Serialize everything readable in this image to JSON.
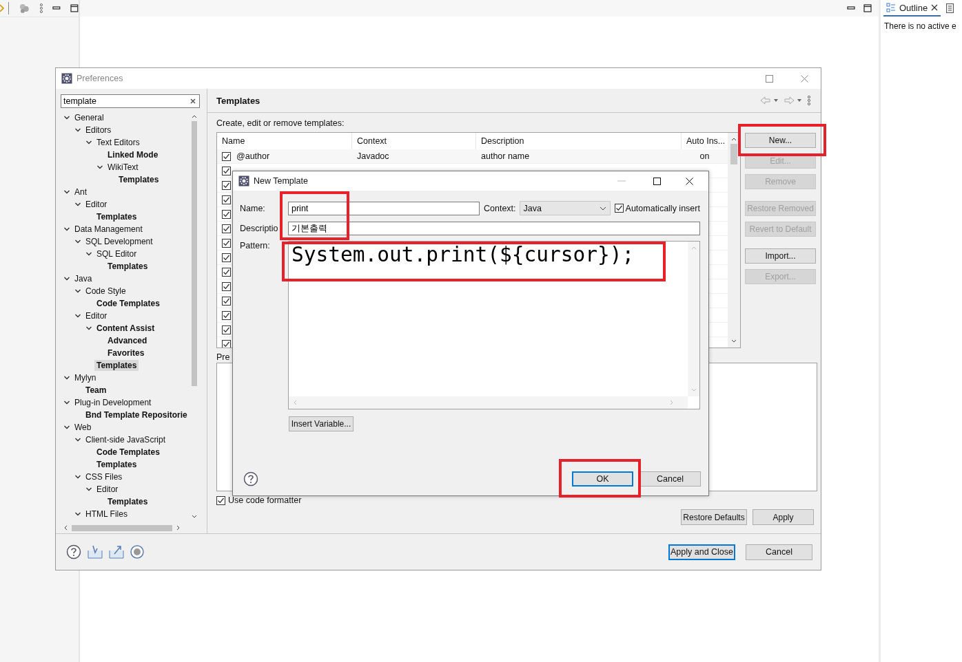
{
  "workbench": {
    "outline_tab": {
      "label": "Outline"
    },
    "outline_message": "There is no active e"
  },
  "preferences": {
    "title": "Preferences",
    "filter": {
      "value": "template"
    },
    "tree": [
      {
        "label": "General",
        "expanded": true,
        "matched": false,
        "selected": false,
        "children": [
          {
            "label": "Editors",
            "expanded": true,
            "matched": false,
            "selected": false,
            "children": [
              {
                "label": "Text Editors",
                "expanded": true,
                "matched": false,
                "selected": false,
                "children": [
                  {
                    "label": "Linked Mode",
                    "matched": true,
                    "selected": false
                  },
                  {
                    "label": "WikiText",
                    "expanded": true,
                    "matched": false,
                    "selected": false,
                    "children": [
                      {
                        "label": "Templates",
                        "matched": true,
                        "selected": false
                      }
                    ]
                  }
                ]
              }
            ]
          }
        ]
      },
      {
        "label": "Ant",
        "expanded": true,
        "matched": false,
        "selected": false,
        "children": [
          {
            "label": "Editor",
            "expanded": true,
            "matched": false,
            "selected": false,
            "children": [
              {
                "label": "Templates",
                "matched": true,
                "selected": false
              }
            ]
          }
        ]
      },
      {
        "label": "Data Management",
        "expanded": true,
        "matched": false,
        "selected": false,
        "children": [
          {
            "label": "SQL Development",
            "expanded": true,
            "matched": false,
            "selected": false,
            "children": [
              {
                "label": "SQL Editor",
                "expanded": true,
                "matched": false,
                "selected": false,
                "children": [
                  {
                    "label": "Templates",
                    "matched": true,
                    "selected": false
                  }
                ]
              }
            ]
          }
        ]
      },
      {
        "label": "Java",
        "expanded": true,
        "matched": false,
        "selected": false,
        "children": [
          {
            "label": "Code Style",
            "expanded": true,
            "matched": false,
            "selected": false,
            "children": [
              {
                "label": "Code Templates",
                "matched": true,
                "selected": false
              }
            ]
          },
          {
            "label": "Editor",
            "expanded": true,
            "matched": false,
            "selected": false,
            "children": [
              {
                "label": "Content Assist",
                "expanded": true,
                "matched": true,
                "selected": false,
                "children": [
                  {
                    "label": "Advanced",
                    "matched": true,
                    "selected": false
                  },
                  {
                    "label": "Favorites",
                    "matched": true,
                    "selected": false
                  }
                ]
              },
              {
                "label": "Templates",
                "matched": true,
                "selected": true
              }
            ]
          }
        ]
      },
      {
        "label": "Mylyn",
        "expanded": true,
        "matched": false,
        "selected": false,
        "children": [
          {
            "label": "Team",
            "matched": true,
            "selected": false
          }
        ]
      },
      {
        "label": "Plug-in Development",
        "expanded": true,
        "matched": false,
        "selected": false,
        "children": [
          {
            "label": "Bnd Template Repositorie",
            "matched": true,
            "selected": false
          }
        ]
      },
      {
        "label": "Web",
        "expanded": true,
        "matched": false,
        "selected": false,
        "children": [
          {
            "label": "Client-side JavaScript",
            "expanded": true,
            "matched": false,
            "selected": false,
            "children": [
              {
                "label": "Code Templates",
                "matched": true,
                "selected": false
              },
              {
                "label": "Templates",
                "matched": true,
                "selected": false
              }
            ]
          },
          {
            "label": "CSS Files",
            "expanded": true,
            "matched": false,
            "selected": false,
            "children": [
              {
                "label": "Editor",
                "expanded": true,
                "matched": false,
                "selected": false,
                "children": [
                  {
                    "label": "Templates",
                    "matched": true,
                    "selected": false
                  }
                ]
              }
            ]
          },
          {
            "label": "HTML Files",
            "expanded": true,
            "matched": false,
            "selected": false
          }
        ]
      }
    ],
    "page": {
      "title": "Templates",
      "intro": "Create, edit or remove templates:",
      "table": {
        "columns": [
          "Name",
          "Context",
          "Description",
          "Auto Ins..."
        ],
        "rows": [
          {
            "checked": true,
            "name": "@author",
            "context": "Javadoc",
            "description": "author name",
            "auto_insert": "on"
          },
          {
            "checked": true
          },
          {
            "checked": true
          },
          {
            "checked": true
          },
          {
            "checked": true
          },
          {
            "checked": true
          },
          {
            "checked": true
          },
          {
            "checked": true
          },
          {
            "checked": true
          },
          {
            "checked": true
          },
          {
            "checked": true
          },
          {
            "checked": true
          },
          {
            "checked": true
          },
          {
            "checked": true
          }
        ]
      },
      "side_button_groups": [
        [
          {
            "label": "New...",
            "disabled": false
          },
          {
            "label": "Edit...",
            "disabled": true
          },
          {
            "label": "Remove",
            "disabled": true
          }
        ],
        [
          {
            "label": "Restore Removed",
            "disabled": true
          },
          {
            "label": "Revert to Default",
            "disabled": true
          }
        ],
        [
          {
            "label": "Import...",
            "disabled": false
          },
          {
            "label": "Export...",
            "disabled": true
          }
        ]
      ],
      "preview_label": "Pre",
      "use_code_formatter": {
        "label": "Use code formatter",
        "checked": true
      },
      "buttons": [
        "Restore Defaults",
        "Apply"
      ]
    },
    "footer_buttons": [
      {
        "label": "Apply and Close",
        "default": true
      },
      {
        "label": "Cancel",
        "default": false
      }
    ]
  },
  "new_template": {
    "title": "New Template",
    "name_label": "Name:",
    "name": "print",
    "context_label": "Context:",
    "context": "Java",
    "auto_insert": {
      "label": "Automatically insert",
      "checked": true
    },
    "description_label": "Descriptio",
    "description": "기본출력",
    "pattern_label": "Pattern:",
    "pattern": "System.out.print(${cursor});",
    "insert_variable": "Insert Variable...",
    "buttons": [
      {
        "label": "OK",
        "default": true
      },
      {
        "label": "Cancel",
        "default": false
      }
    ]
  }
}
